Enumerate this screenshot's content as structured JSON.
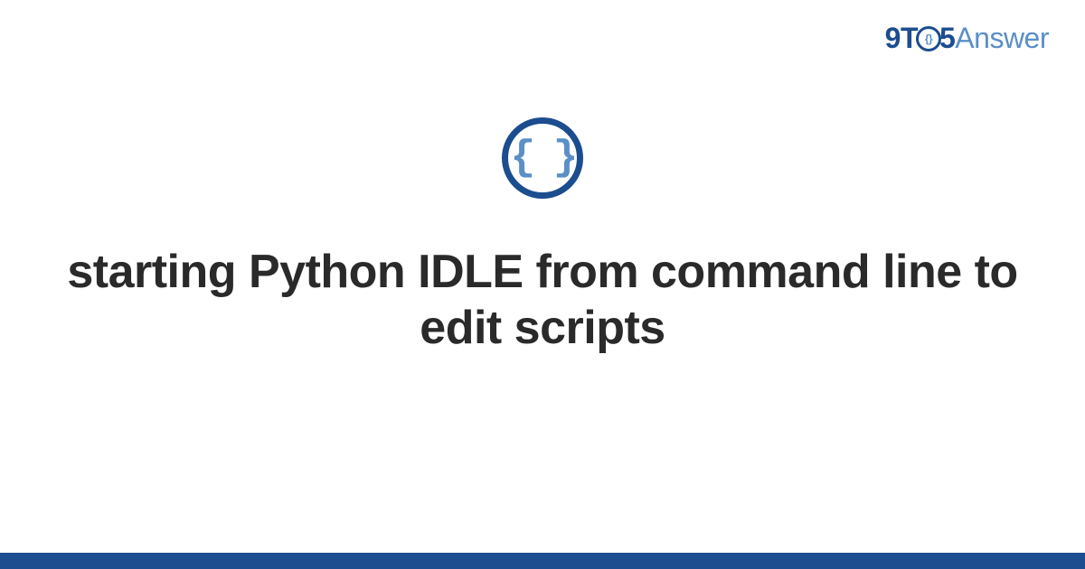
{
  "brand": {
    "part1": "9",
    "part2": "T",
    "part3_inner": "{}",
    "part4": "5",
    "part5": "Answer"
  },
  "icon": {
    "glyph": "{ }"
  },
  "title": "starting Python IDLE from command line to edit scripts",
  "colors": {
    "primary": "#1b4d8f",
    "secondary": "#5a8fc7",
    "text": "#2a2a2a"
  }
}
